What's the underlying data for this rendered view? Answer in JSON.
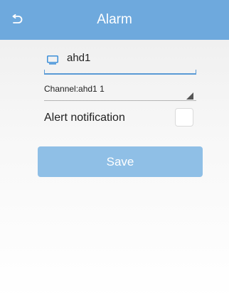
{
  "header": {
    "title": "Alarm",
    "back_icon": "back-arrow-icon",
    "background": "#6ea9dd"
  },
  "device": {
    "icon": "monitor-icon",
    "name": "ahd1",
    "accent": "#5a9ad5"
  },
  "channel": {
    "selected": "Channel:ahd1 1"
  },
  "alert": {
    "label": "Alert notification",
    "checked": false
  },
  "actions": {
    "save_label": "Save",
    "save_color": "#8fbfe6"
  }
}
